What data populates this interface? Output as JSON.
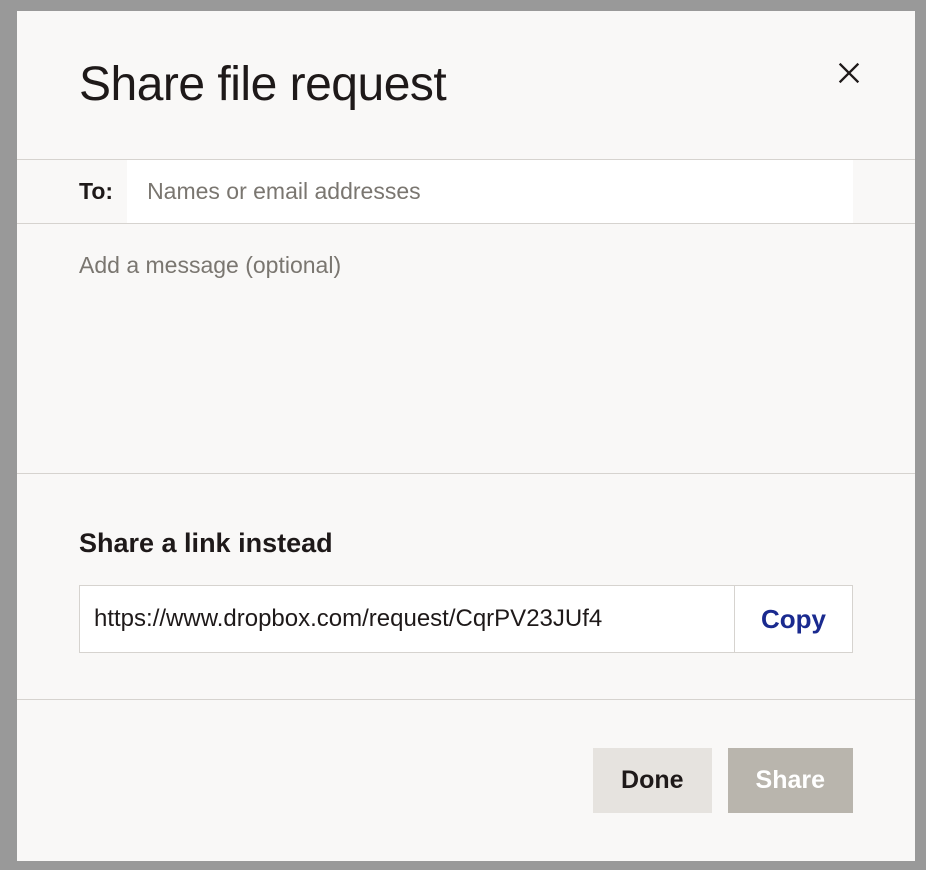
{
  "modal": {
    "title": "Share file request",
    "to_label": "To:",
    "to_placeholder": "Names or email addresses",
    "message_placeholder": "Add a message (optional)",
    "link_heading": "Share a link instead",
    "link_value": "https://www.dropbox.com/request/CqrPV23JUf4",
    "copy_label": "Copy",
    "done_label": "Done",
    "share_label": "Share"
  }
}
